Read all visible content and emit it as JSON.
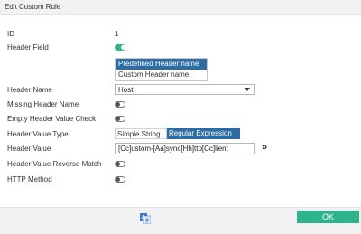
{
  "dialog": {
    "title": "Edit Custom Rule"
  },
  "fields": {
    "id": {
      "label": "ID",
      "value": "1"
    },
    "header_field": {
      "label": "Header Field",
      "enabled": true,
      "options": [
        "Predefined Header name",
        "Custom Header name"
      ],
      "selected": "Predefined Header name"
    },
    "header_name": {
      "label": "Header Name",
      "value": "Host"
    },
    "missing_header_name": {
      "label": "Missing Header Name",
      "enabled": false
    },
    "empty_header_value_check": {
      "label": "Empty Header Value Check",
      "enabled": false
    },
    "header_value_type": {
      "label": "Header Value Type",
      "options": [
        "Simple String",
        "Regular Expression"
      ],
      "selected": "Regular Expression"
    },
    "header_value": {
      "label": "Header Value",
      "value": "[Cc]ustom-[Aa]sync[Hh]ttp[Cc]lient"
    },
    "header_value_reverse_match": {
      "label": "Header Value Reverse Match",
      "enabled": false
    },
    "http_method": {
      "label": "HTTP Method",
      "enabled": false
    }
  },
  "footer": {
    "ok_label": "OK"
  },
  "colors": {
    "accent_green": "#2fb38a",
    "select_blue": "#2e6da4"
  },
  "icons": {
    "expand": "double-chevron-right-icon",
    "translate": "translate-icon"
  }
}
